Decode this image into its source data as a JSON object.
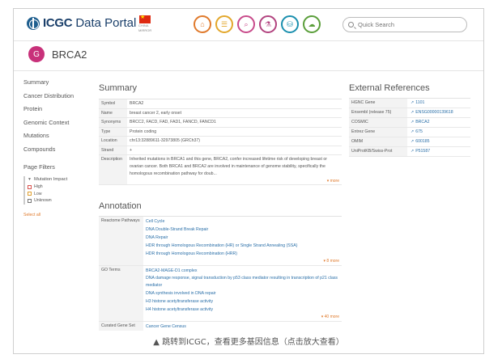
{
  "header": {
    "logo_bold": "ICGC",
    "logo_light": "Data Portal",
    "mirror_line1": "CHINA",
    "mirror_line2": "MIRROR",
    "nav_icons": [
      "home-icon",
      "projects-icon",
      "search-icon",
      "analysis-icon",
      "repository-icon",
      "download-icon"
    ],
    "search_placeholder": "Quick Search"
  },
  "gene": {
    "badge": "G",
    "symbol": "BRCA2"
  },
  "left_nav": {
    "items": [
      "Summary",
      "Cancer Distribution",
      "Protein",
      "Genomic Context",
      "Mutations",
      "Compounds"
    ],
    "filters_title": "Page Filters",
    "filter_group": "Mutation Impact",
    "options": [
      {
        "label": "High",
        "color": "#d9534f"
      },
      {
        "label": "Low",
        "color": "#e0a030"
      },
      {
        "label": "Unknown",
        "color": "#777777"
      }
    ],
    "select_all": "Select all"
  },
  "summary": {
    "title": "Summary",
    "rows": [
      {
        "key": "Symbol",
        "value": "BRCA2"
      },
      {
        "key": "Name",
        "value": "breast cancer 2, early onset"
      },
      {
        "key": "Synonyms",
        "value": "BRCC2, FACD, FAD, FAD1, FANCD, FANCD1"
      },
      {
        "key": "Type",
        "value": "Protein coding"
      },
      {
        "key": "Location",
        "value": "chr13:32889611-32973805 (GRCh37)"
      },
      {
        "key": "Strand",
        "value": "+"
      }
    ],
    "description_key": "Description",
    "description": "Inherited mutations in BRCA1 and this gene, BRCA2, confer increased lifetime risk of developing breast or ovarian cancer. Both BRCA1 and BRCA2 are involved in maintenance of genome stability, specifically the homologous recombination pathway for doub...",
    "more": "▾ more"
  },
  "annotation": {
    "title": "Annotation",
    "reactome_key": "Reactome Pathways",
    "reactome": [
      "Cell Cycle",
      "DNA Double-Strand Break Repair",
      "DNA Repair",
      "HDR through Homologous Recombination (HR) or Single Strand Annealing (SSA)",
      "HDR through Homologous Recombination (HRR)"
    ],
    "reactome_more": "▾ 8 more",
    "go_key": "GO Terms",
    "go": [
      "BRCA2-MAGE-D1 complex",
      "DNA damage response, signal transduction by p53 class mediator resulting in transcription of p21 class mediator",
      "DNA synthesis involved in DNA repair",
      "H3 histone acetyltransferase activity",
      "H4 histone acetyltransferase activity"
    ],
    "go_more": "▾ 40 more",
    "curated_key": "Curated Gene Set",
    "curated": "Cancer Gene Census"
  },
  "external": {
    "title": "External References",
    "rows": [
      {
        "key": "HGNC Gene",
        "value": "1101"
      },
      {
        "key": "Ensembl (release 75)",
        "value": "ENSG00000139618"
      },
      {
        "key": "COSMIC",
        "value": "BRCA2"
      },
      {
        "key": "Entrez Gene",
        "value": "675"
      },
      {
        "key": "OMIM",
        "value": "600185"
      },
      {
        "key": "UniProtKB/Swiss-Prot",
        "value": "P51587"
      }
    ]
  },
  "caption": "▲ 跳转到ICGC，查看更多基因信息（点击放大查看）"
}
